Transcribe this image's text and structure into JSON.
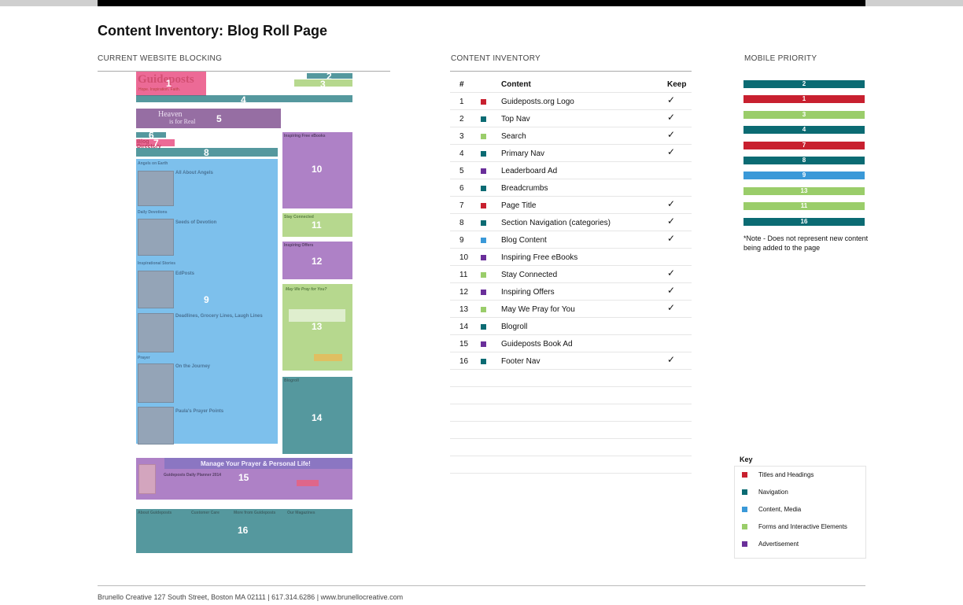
{
  "page_title": "Content Inventory: Blog Roll Page",
  "sections": {
    "current": "CURRENT WEBSITE BLOCKING",
    "inventory": "CONTENT INVENTORY",
    "mobile": "MOBILE PRIORITY"
  },
  "colors": {
    "titles": "#c8202f",
    "navigation": "#0b6b73",
    "content": "#3a99d8",
    "forms": "#9acd6a",
    "ad": "#6a2f9a",
    "wf_title": "#e8467c",
    "wf_nav": "#2b7f86",
    "wf_content": "#5db1e8",
    "wf_form": "#a5cf73",
    "wf_ad": "#9b62b8"
  },
  "wireframe": {
    "blocks": [
      "1",
      "2",
      "3",
      "4",
      "5",
      "6",
      "7",
      "8",
      "9",
      "10",
      "11",
      "12",
      "13",
      "14",
      "15",
      "16"
    ],
    "mock_text": {
      "logo": "Guideposts",
      "tagline": "Hope. Inspiration. Faith.",
      "banner_left": "Heaven",
      "banner_right": "is for Real",
      "blog_dir": "Blog Directory",
      "angels": "Angels on Earth",
      "post1": "All About Angels",
      "devotions": "Daily Devotions",
      "post2": "Seeds of Devotion",
      "inspirational": "Inspirational Stories",
      "post3": "EdPosts",
      "post4": "Deadlines, Grocery Lines, Laugh Lines",
      "prayer": "Prayer",
      "post5": "On the Journey",
      "post6": "Paula's Prayer Points",
      "ebooks": "Inspiring Free eBooks",
      "connected": "Stay Connected",
      "offers": "Inspiring Offers",
      "pray": "May We Pray for You?",
      "blogroll": "Blogroll",
      "book_banner": "Manage Your Prayer & Personal Life!",
      "book_title": "Guideposts Daily Planner 2014",
      "footer_cols": [
        "About Guideposts",
        "Customer Care",
        "More from Guideposts",
        "Our Magazines"
      ]
    }
  },
  "inventory": {
    "headers": {
      "num": "#",
      "content": "Content",
      "keep": "Keep"
    },
    "rows": [
      {
        "num": "1",
        "name": "Guideposts.org Logo",
        "keep": "✓",
        "cat": "titles"
      },
      {
        "num": "2",
        "name": "Top Nav",
        "keep": "✓",
        "cat": "navigation"
      },
      {
        "num": "3",
        "name": "Search",
        "keep": "✓",
        "cat": "forms"
      },
      {
        "num": "4",
        "name": "Primary Nav",
        "keep": "✓",
        "cat": "navigation"
      },
      {
        "num": "5",
        "name": "Leaderboard Ad",
        "keep": "",
        "cat": "ad"
      },
      {
        "num": "6",
        "name": "Breadcrumbs",
        "keep": "",
        "cat": "navigation"
      },
      {
        "num": "7",
        "name": "Page Title",
        "keep": "✓",
        "cat": "titles"
      },
      {
        "num": "8",
        "name": "Section Navigation (categories)",
        "keep": "✓",
        "cat": "navigation"
      },
      {
        "num": "9",
        "name": "Blog Content",
        "keep": "✓",
        "cat": "content"
      },
      {
        "num": "10",
        "name": "Inspiring Free eBooks",
        "keep": "",
        "cat": "ad"
      },
      {
        "num": "11",
        "name": "Stay Connected",
        "keep": "✓",
        "cat": "forms"
      },
      {
        "num": "12",
        "name": "Inspiring Offers",
        "keep": "✓",
        "cat": "ad"
      },
      {
        "num": "13",
        "name": "May We Pray for You",
        "keep": "✓",
        "cat": "forms"
      },
      {
        "num": "14",
        "name": "Blogroll",
        "keep": "",
        "cat": "navigation"
      },
      {
        "num": "15",
        "name": "Guideposts Book Ad",
        "keep": "",
        "cat": "ad"
      },
      {
        "num": "16",
        "name": "Footer Nav",
        "keep": "✓",
        "cat": "navigation"
      }
    ]
  },
  "mobile_priority": [
    {
      "label": "2",
      "cat": "navigation"
    },
    {
      "label": "1",
      "cat": "titles"
    },
    {
      "label": "3",
      "cat": "forms"
    },
    {
      "label": "4",
      "cat": "navigation"
    },
    {
      "label": "7",
      "cat": "titles"
    },
    {
      "label": "8",
      "cat": "navigation"
    },
    {
      "label": "9",
      "cat": "content"
    },
    {
      "label": "13",
      "cat": "forms"
    },
    {
      "label": "11",
      "cat": "forms"
    },
    {
      "label": "16",
      "cat": "navigation"
    }
  ],
  "note": "*Note - Does not represent new content being added to the page",
  "key": {
    "title": "Key",
    "items": [
      {
        "label": "Titles and Headings",
        "cat": "titles"
      },
      {
        "label": "Navigation",
        "cat": "navigation"
      },
      {
        "label": "Content, Media",
        "cat": "content"
      },
      {
        "label": "Forms and Interactive Elements",
        "cat": "forms"
      },
      {
        "label": "Advertisement",
        "cat": "ad"
      }
    ]
  },
  "footer": "Brunello Creative 127 South Street, Boston MA 02111 | 617.314.6286 | www.brunellocreative.com"
}
